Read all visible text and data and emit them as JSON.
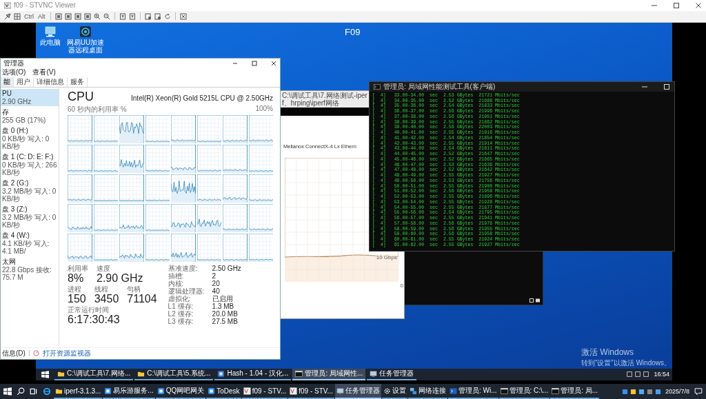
{
  "viewer": {
    "title": "f09 - STVNC Viewer",
    "toolbar_keys": [
      "Ctrl",
      "Alt"
    ]
  },
  "remote_desktop": {
    "hostname": "F09",
    "icons": [
      {
        "label": "此电脑"
      },
      {
        "label": "网易UU加速器远程桌面"
      }
    ],
    "activation": {
      "title": "激活 Windows",
      "hint": "转到“设置”以激活 Windows。"
    }
  },
  "task_manager": {
    "title": "管理器",
    "menu": [
      "选项(O)",
      "查看(V)"
    ],
    "tabs": [
      {
        "label": "能",
        "selected": true
      },
      {
        "label": "用户",
        "selected": false
      },
      {
        "label": "详细信息",
        "selected": false
      },
      {
        "label": "服务",
        "selected": false
      }
    ],
    "resources": [
      {
        "name": "PU",
        "detail": "2.90 GHz",
        "selected": true
      },
      {
        "name": "存",
        "detail": "255 GB (17%)",
        "selected": false
      },
      {
        "name": "盘 0 (H:)",
        "detail": "0 KB/秒 写入: 0 KB/秒",
        "selected": false
      },
      {
        "name": "盘 1 (C: D: E: F:)",
        "detail": "0 KB/秒 写入: 266 KB/秒",
        "selected": false
      },
      {
        "name": "盘 2 (G:)",
        "detail": "3.2 MB/秒 写入: 0 KB/秒",
        "selected": false
      },
      {
        "name": "盘 3 (Z:)",
        "detail": "3.2 MB/秒 写入: 0 KB/秒",
        "selected": false
      },
      {
        "name": "盘 4 (W:)",
        "detail": "4.1 KB/秒 写入: 4.1 MB/",
        "selected": false
      },
      {
        "name": "太网",
        "detail": "22.8 Gbps 接收: 75.7 M",
        "selected": false
      }
    ],
    "cpu": {
      "heading": "CPU",
      "model": "Intel(R) Xeon(R) Gold 5215L CPU @ 2.50GHz",
      "graph_label": "60 秒内的利用率 %",
      "graph_max": "100%",
      "stat_rows": [
        [
          {
            "label": "利用率",
            "value": "8%"
          },
          {
            "label": "速度",
            "value": "2.90 GHz"
          }
        ],
        [
          {
            "label": "进程",
            "value": "150"
          },
          {
            "label": "线程",
            "value": "3450"
          },
          {
            "label": "句柄",
            "value": "71104"
          }
        ],
        [
          {
            "label": "正常运行时间",
            "value": "6:17:30:43"
          }
        ]
      ],
      "details": [
        {
          "label": "基准速度:",
          "value": "2.50 GHz"
        },
        {
          "label": "插槽:",
          "value": "2"
        },
        {
          "label": "内核:",
          "value": "20"
        },
        {
          "label": "逻辑处理器:",
          "value": "40"
        },
        {
          "label": "虚拟化:",
          "value": "已启用"
        },
        {
          "label": "L1 缓存:",
          "value": "1.3 MB"
        },
        {
          "label": "L2 缓存:",
          "value": "20.0 MB"
        },
        {
          "label": "L3 缓存:",
          "value": "27.5 MB"
        }
      ]
    },
    "footer": {
      "collapse": "信息(D)",
      "link": "打开资源监视器"
    }
  },
  "network_window": {
    "title": "C:\\调试工具\\7.网络测试-iperf、hrping\\iperf网络",
    "adapter": "Mellanox ConnectX-4 Lx Ethern",
    "scale_max": "10 Gbps",
    "scale_min": "0"
  },
  "terminal": {
    "title": "管理员: 局域网性能测试工具(客户端)",
    "lines": [
      "[  4]   33.00-34.00  sec  2.53 GBytes  21721 Mbits/sec",
      "[  4]   34.00-35.00  sec  2.52 GBytes  21688 Mbits/sec",
      "[  4]   35.00-36.00  sec  2.54 GBytes  21833 Mbits/sec",
      "[  4]   36.00-37.00  sec  2.56 GBytes  21996 Mbits/sec",
      "[  4]   37.00-38.00  sec  2.56 GBytes  21951 Mbits/sec",
      "[  4]   38.00-39.00  sec  2.55 GBytes  21862 Mbits/sec",
      "[  4]   39.00-40.00  sec  2.56 GBytes  22003 Mbits/sec",
      "[  4]   40.00-41.00  sec  2.55 GBytes  21916 Mbits/sec",
      "[  4]   41.00-42.00  sec  2.54 GBytes  21854 Mbits/sec",
      "[  4]   42.00-43.00  sec  2.55 GBytes  21914 Mbits/sec",
      "[  4]   43.00-44.00  sec  2.54 GBytes  21811 Mbits/sec",
      "[  4]   44.00-45.00  sec  2.52 GBytes  21647 Mbits/sec",
      "[  4]   45.00-46.00  sec  2.52 GBytes  21665 Mbits/sec",
      "[  4]   46.00-47.00  sec  2.53 GBytes  21636 Mbits/sec",
      "[  4]   47.00-48.00  sec  2.52 GBytes  21642 Mbits/sec",
      "[  4]   48.00-49.00  sec  2.55 GBytes  21927 Mbits/sec",
      "[  4]   49.00-50.00  sec  2.53 GBytes  21756 Mbits/sec",
      "[  4]   50.00-51.00  sec  2.55 GBytes  21900 Mbits/sec",
      "[  4]   51.00-52.00  sec  2.56 GBytes  21958 Mbits/sec",
      "[  4]   52.00-53.00  sec  2.55 GBytes  21896 Mbits/sec",
      "[  4]   53.00-54.00  sec  2.55 GBytes  21928 Mbits/sec",
      "[  4]   54.00-55.00  sec  2.55 GBytes  21877 Mbits/sec",
      "[  4]   55.00-56.00  sec  2.54 GBytes  21795 Mbits/sec",
      "[  4]   56.00-57.00  sec  2.55 GBytes  21941 Mbits/sec",
      "[  4]   57.00-58.00  sec  2.56 GBytes  21976 Mbits/sec",
      "[  4]   58.00-59.00  sec  2.56 GBytes  21955 Mbits/sec",
      "[  4]   59.00-60.00  sec  2.56 GBytes  21958 Mbits/sec",
      "[  4]   60.00-61.00  sec  2.55 GBytes  21924 Mbits/sec",
      "[  4]   61.00-62.00  sec  2.55 GBytes  21927 Mbits/sec"
    ]
  },
  "remote_taskbar": {
    "items": [
      {
        "label": "C:\\调试工具\\7.网络...",
        "kind": "folder",
        "active": false
      },
      {
        "label": "C:\\调试工具\\5.系统...",
        "kind": "folder",
        "active": false
      },
      {
        "label": "Hash - 1.04 - 汉化...",
        "kind": "app",
        "active": false
      },
      {
        "label": "管理员: 局域网性...",
        "kind": "terminal",
        "active": true
      },
      {
        "label": "任务管理器",
        "kind": "monitor",
        "active": false
      }
    ],
    "clock": "16:54"
  },
  "taskbar": {
    "items": [
      {
        "label": "iperf-3.1.3...",
        "kind": "folder",
        "active": false
      },
      {
        "label": "易乐游服务...",
        "kind": "app",
        "active": false
      },
      {
        "label": "QQ网吧网关",
        "kind": "app",
        "active": false
      },
      {
        "label": "ToDesk",
        "kind": "app",
        "active": false
      },
      {
        "label": "f09 - STV...",
        "kind": "viewer",
        "active": false
      },
      {
        "label": "f09 - STV...",
        "kind": "viewer",
        "active": false
      },
      {
        "label": "任务管理器",
        "kind": "monitor",
        "active": true
      },
      {
        "label": "设置",
        "kind": "gear",
        "active": false
      },
      {
        "label": "网络连接",
        "kind": "network",
        "active": false
      },
      {
        "label": "管理员: Wi...",
        "kind": "prompt",
        "active": false
      },
      {
        "label": "管理员: C:\\...",
        "kind": "terminal",
        "active": false
      },
      {
        "label": "管理员: 局...",
        "kind": "terminal",
        "active": false
      }
    ],
    "date": "2025/7/8"
  }
}
